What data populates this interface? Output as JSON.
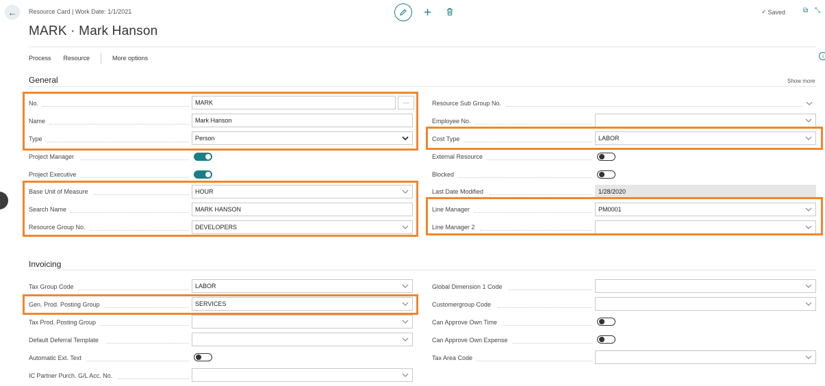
{
  "header": {
    "caption": "Resource Card | Work Date: 1/1/2021",
    "title": "MARK · Mark Hanson",
    "saved_label": "Saved",
    "saved_check": "✓"
  },
  "actions": {
    "process": "Process",
    "resource": "Resource",
    "more_options": "More options"
  },
  "general": {
    "title": "General",
    "show_more": "Show more",
    "no_label": "No.",
    "no_value": "MARK",
    "no_assist": "···",
    "name_label": "Name",
    "name_value": "Mark Hanson",
    "type_label": "Type",
    "type_value": "Person",
    "pm_label": "Project Manager",
    "pe_label": "Project Executive",
    "buom_label": "Base Unit of Measure",
    "buom_value": "HOUR",
    "search_label": "Search Name",
    "search_value": "MARK HANSON",
    "rgroup_label": "Resource Group No.",
    "rgroup_value": "DEVELOPERS",
    "rsub_label": "Resource Sub Group No.",
    "emp_label": "Employee No.",
    "emp_value": "",
    "cost_label": "Cost Type",
    "cost_value": "LABOR",
    "ext_label": "External Resource",
    "blocked_label": "Blocked",
    "lastmod_label": "Last Date Modified",
    "lastmod_value": "1/28/2020",
    "lm_label": "Line Manager",
    "lm_value": "PM0001",
    "lm2_label": "Line Manager 2",
    "lm2_value": "",
    "toggles": {
      "pm": true,
      "pe": true,
      "ext": false,
      "blocked": false
    }
  },
  "invoicing": {
    "title": "Invoicing",
    "tax_label": "Tax Group Code",
    "tax_value": "LABOR",
    "gen_label": "Gen. Prod. Posting Group",
    "gen_value": "SERVICES",
    "taxprod_label": "Tax Prod. Posting Group",
    "taxprod_value": "",
    "deferral_label": "Default Deferral Template",
    "deferral_value": "",
    "autoext_label": "Automatic Ext. Text",
    "ic_label": "IC Partner Purch. G/L Acc. No.",
    "ic_value": "",
    "gd1_label": "Global Dimension 1 Code",
    "gd1_value": "",
    "cust_label": "Customergroup Code",
    "cust_value": "",
    "aot_label": "Can Approve Own Time",
    "aoe_label": "Can Approve Own Expense",
    "taxarea_label": "Tax Area Code",
    "taxarea_value": "",
    "toggles": {
      "autoext": false,
      "aot": false,
      "aoe": false
    }
  },
  "colors": {
    "accent": "#1a7e86",
    "highlight": "#f0862a"
  }
}
